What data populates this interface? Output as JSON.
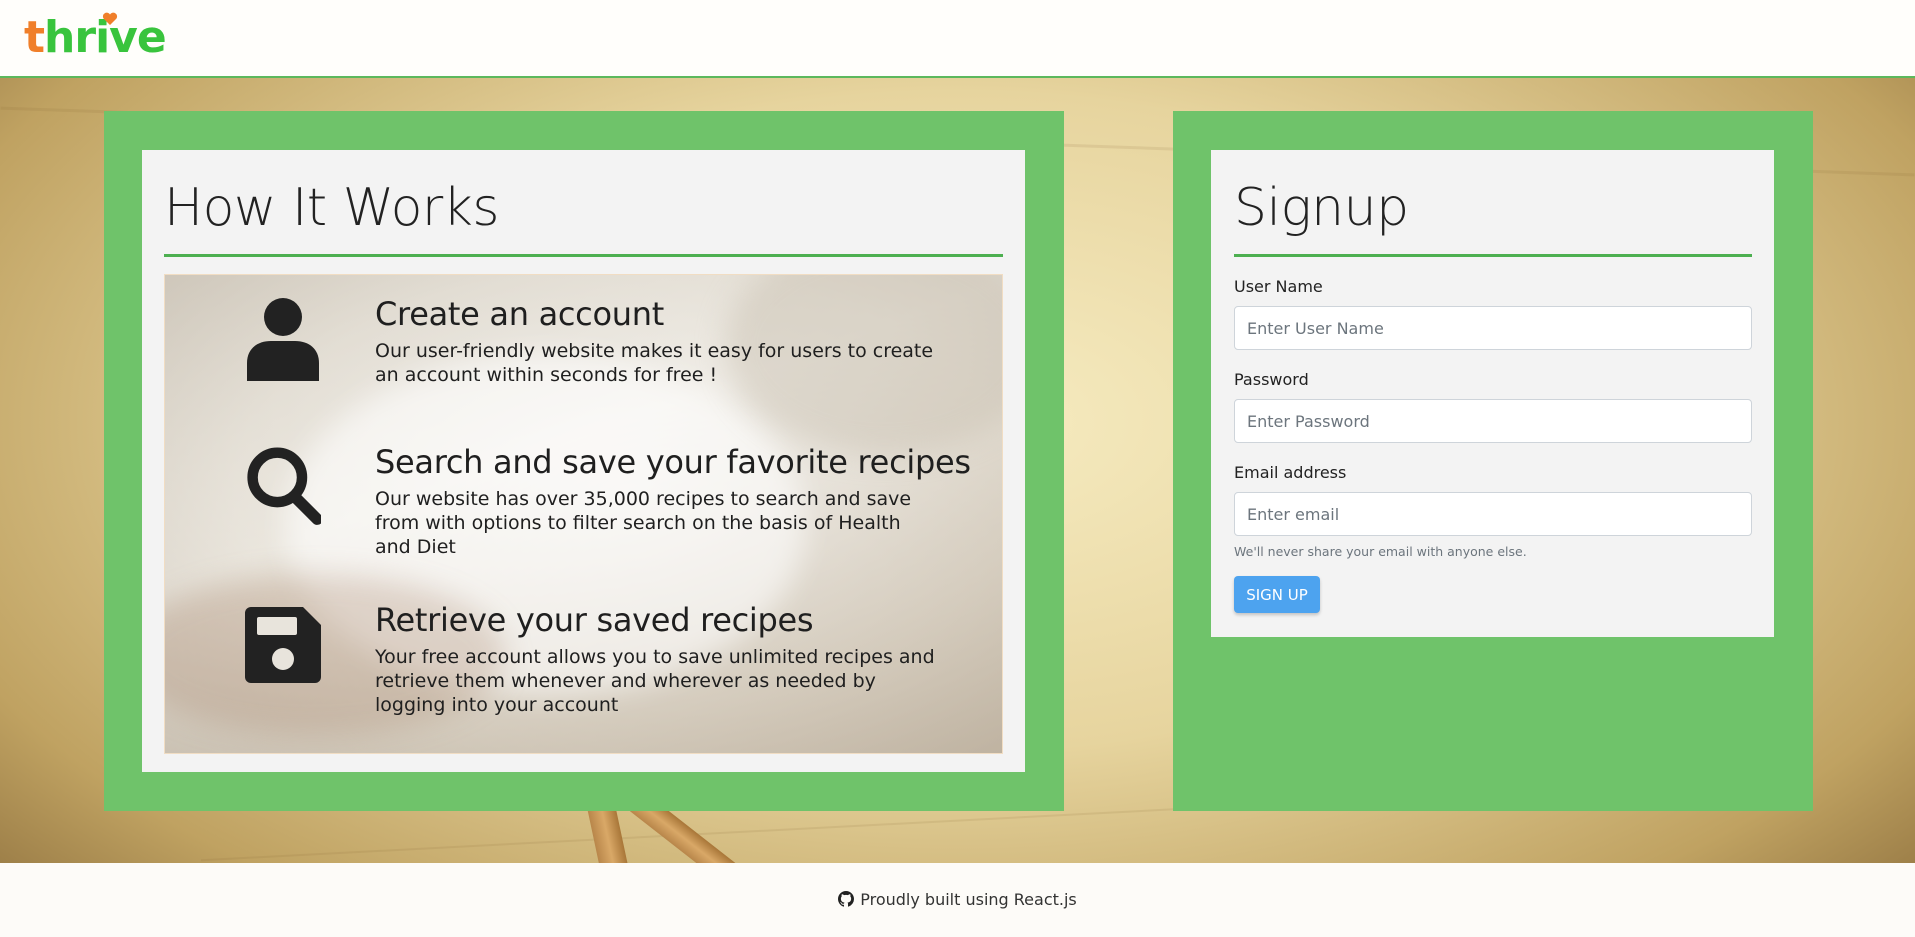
{
  "brand": {
    "logo_t": "t",
    "logo_rest": "hrive",
    "logo_color_t": "#f07f2a",
    "logo_color_rest": "#39c43d"
  },
  "how_it_works": {
    "title": "How It Works",
    "features": [
      {
        "icon": "user-icon",
        "title": "Create an account",
        "text": "Our user-friendly website makes it easy for users to create an account within seconds for free !"
      },
      {
        "icon": "search-icon",
        "title": "Search and save your favorite recipes",
        "text": "Our website has over 35,000 recipes to search and save from with options to filter search on the basis of Health and Diet"
      },
      {
        "icon": "save-icon",
        "title": "Retrieve your saved recipes",
        "text": "Your free account allows you to save unlimited recipes and retrieve them whenever and wherever as needed by logging into your account"
      }
    ]
  },
  "signup": {
    "title": "Signup",
    "username_label": "User Name",
    "username_placeholder": "Enter User Name",
    "password_label": "Password",
    "password_placeholder": "Enter Password",
    "email_label": "Email address",
    "email_placeholder": "Enter email",
    "email_help": "We'll never share your email with anyone else.",
    "button_label": "Sign Up"
  },
  "footer": {
    "icon": "github-icon",
    "text": "Proudly built using React.js"
  },
  "colors": {
    "accent_green": "#4caf50",
    "panel_green": "#6fc36a",
    "button_blue": "#4da3ef"
  }
}
